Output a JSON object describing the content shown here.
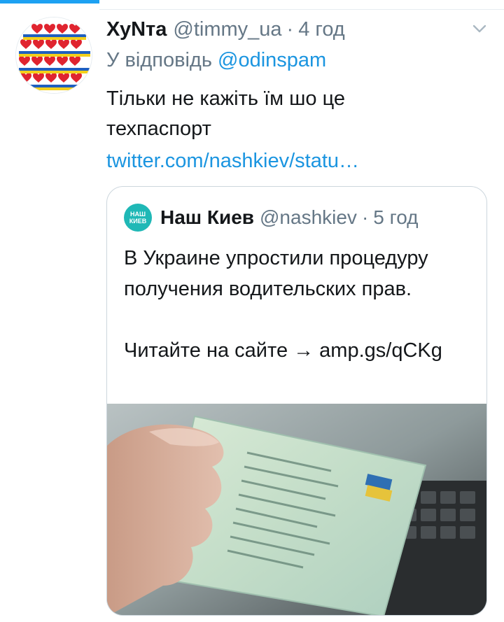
{
  "tweet": {
    "author_name": "ХуNта",
    "author_handle": "@timmy_ua",
    "separator": "·",
    "timestamp": "4 год",
    "reply_prefix": "У відповідь",
    "reply_mention": "@odinspam",
    "text": "Тільки не кажіть їм шо це техпаспорт",
    "link": "twitter.com/nashkiev/statu…"
  },
  "quoted_tweet": {
    "avatar_text_top": "НАШ",
    "avatar_text_bottom": "КИЕВ",
    "author_name": "Наш Киев",
    "author_handle": "@nashkiev",
    "separator": "·",
    "timestamp": "5 год",
    "text_line_1": "В Украине упростили процедуру получения водительских прав.",
    "text_line_2": "Читайте на сайте → amp.gs/qCKg"
  },
  "icons": {
    "chevron": "chevron-down-icon",
    "avatar": "hearts-pattern-avatar",
    "media": "vehicle-registration-card-photo"
  },
  "colors": {
    "accent": "#1da1f2",
    "link": "#1b95e0",
    "muted": "#657786",
    "text": "#14171a",
    "border": "#ccd6dd",
    "quote_avatar_bg": "#1fb8b6"
  }
}
